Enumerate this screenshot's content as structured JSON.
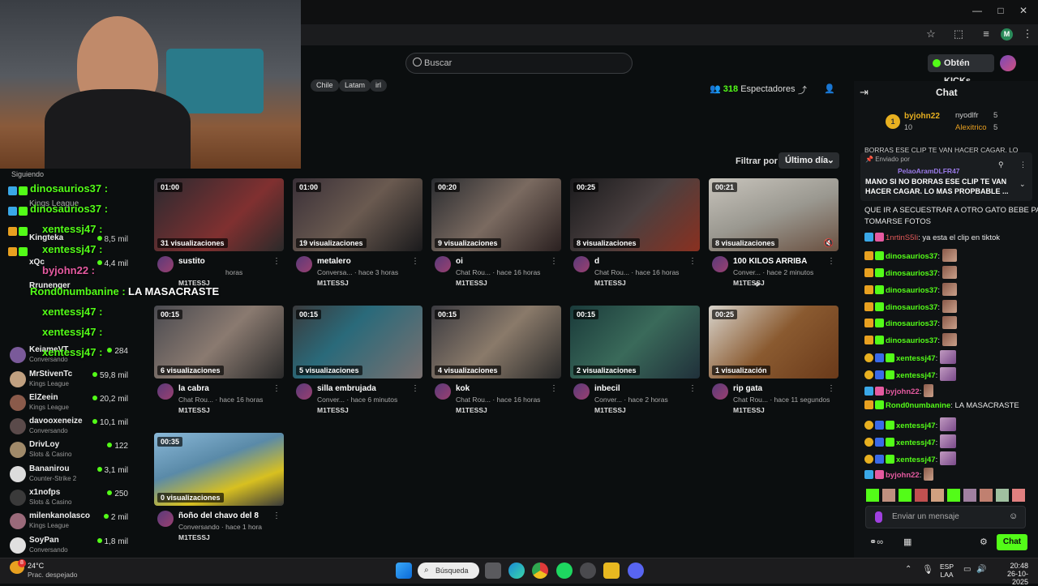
{
  "browser": {
    "window_controls": [
      "—",
      "□",
      "✕"
    ]
  },
  "header": {
    "search_placeholder": "Buscar",
    "kicks_button": "Obtén KICKs"
  },
  "stream": {
    "tags": [
      "Chile",
      "Latam",
      "irl"
    ],
    "viewers_count": "318",
    "viewers_label": "Espectadores"
  },
  "clips": {
    "filter_label": "Filtrar por:",
    "filter_value": "Último día",
    "items": [
      {
        "duration": "01:00",
        "views": "31 visualizaciones",
        "title": "sustito",
        "meta": "horas",
        "user": "M1TESSJ"
      },
      {
        "duration": "01:00",
        "views": "19 visualizaciones",
        "title": "metalero",
        "meta": "Conversa... · hace 3 horas",
        "user": "M1TESSJ"
      },
      {
        "duration": "00:20",
        "views": "9 visualizaciones",
        "title": "oi",
        "meta": "Chat Rou... · hace 16 horas",
        "user": "M1TESSJ"
      },
      {
        "duration": "00:25",
        "views": "8 visualizaciones",
        "title": "d",
        "meta": "Chat Rou... · hace 16 horas",
        "user": "M1TESSJ"
      },
      {
        "duration": "00:21",
        "views": "8 visualizaciones",
        "title": "100 KILOS ARRIBA",
        "meta": "Conver... · hace 2 minutos",
        "user": "M1TESSJ"
      },
      {
        "duration": "00:15",
        "views": "6 visualizaciones",
        "title": "la cabra",
        "meta": "Chat Rou... · hace 16 horas",
        "user": "M1TESSJ"
      },
      {
        "duration": "00:15",
        "views": "5 visualizaciones",
        "title": "silla embrujada",
        "meta": "Conver... · hace 6 minutos",
        "user": "M1TESSJ"
      },
      {
        "duration": "00:15",
        "views": "4 visualizaciones",
        "title": "kok",
        "meta": "Chat Rou... · hace 16 horas",
        "user": "M1TESSJ"
      },
      {
        "duration": "00:15",
        "views": "2 visualizaciones",
        "title": "inbecil",
        "meta": "Conver... · hace 2 horas",
        "user": "M1TESSJ"
      },
      {
        "duration": "00:25",
        "views": "1 visualización",
        "title": "rip gata",
        "meta": "Chat Rou... · hace 11 segundos",
        "user": "M1TESSJ"
      },
      {
        "duration": "00:35",
        "views": "0 visualizaciones",
        "title": "ñoño del chavo del 8",
        "meta": "Conversando · hace 1 hora",
        "user": "M1TESSJ"
      }
    ]
  },
  "sidebar": {
    "heading": "Siguiendo",
    "items": [
      {
        "name": "Kings League",
        "category": "",
        "count": ""
      },
      {
        "name": "Kingteka",
        "category": "",
        "count": "8,5 mil"
      },
      {
        "name": "xQc",
        "category": "",
        "count": "4,4 mil"
      },
      {
        "name": "Rrunenger",
        "category": "",
        "count": ""
      },
      {
        "name": "KeiameVT",
        "category": "Conversando",
        "count": "284"
      },
      {
        "name": "MrStivenTc",
        "category": "Kings League",
        "count": "59,8 mil"
      },
      {
        "name": "ElZeein",
        "category": "Kings League",
        "count": "20,2 mil"
      },
      {
        "name": "davooxeneize",
        "category": "Conversando",
        "count": "10,1 mil"
      },
      {
        "name": "DrivLoy",
        "category": "Slots & Casino",
        "count": "122"
      },
      {
        "name": "Bananirou",
        "category": "Counter-Strike 2",
        "count": "3,1 mil"
      },
      {
        "name": "x1nofps",
        "category": "Slots & Casino",
        "count": "250"
      },
      {
        "name": "milenkanolasco",
        "category": "Kings League",
        "count": "2 mil"
      },
      {
        "name": "SoyPan",
        "category": "Conversando",
        "count": "1,8 mil"
      }
    ]
  },
  "overlay_chat": [
    {
      "text": "dinosaurios37 :",
      "color": "#53fc18"
    },
    {
      "text": "dinosaurios37 :",
      "color": "#53fc18"
    },
    {
      "text": "xentessj47 :",
      "color": "#53fc18"
    },
    {
      "text": "xentessj47 :",
      "color": "#53fc18"
    },
    {
      "text": "byjohn22 :",
      "color": "#e55aa0"
    },
    {
      "text": "Rond0numbanine :",
      "color": "#53fc18",
      "message": "LA MASACRASTE"
    },
    {
      "text": "xentessj47 :",
      "color": "#53fc18"
    },
    {
      "text": "xentessj47 :",
      "color": "#53fc18"
    },
    {
      "text": "xentessj47 :",
      "color": "#53fc18"
    }
  ],
  "chat": {
    "title": "Chat",
    "top_gifters": [
      {
        "rank": "1",
        "name": "byjohn22",
        "count": "10"
      },
      {
        "name": "nyodlfr",
        "count": "5"
      },
      {
        "name": "Alexitrico",
        "count": "5"
      }
    ],
    "pinned_cut": "BORRAS ESE CLIP TE VAN HACER CAGAR. LO",
    "pinned_by_label": "Enviado por",
    "pinned_user": "PelaoAramDLFR47",
    "pinned_message": "MANO SI NO BORRAS ESE CLIP TE VAN HACER CAGAR. LO MAS PROPBABLE ...",
    "messages": [
      {
        "user": "",
        "text": "QUE IR A SECUESTRAR A OTRO GATO BEBE PA",
        "color": "#e8e8e8"
      },
      {
        "user": "",
        "text": "TOMARSE FOTOS",
        "color": "#e8e8e8"
      },
      {
        "user": "1nrtinS5Ii",
        "text": ": ya esta el clip en tiktok",
        "color": "#e55a5a"
      },
      {
        "user": "dinosaurios37",
        "text": ":",
        "color": "#53fc18"
      },
      {
        "user": "dinosaurios37",
        "text": ":",
        "color": "#53fc18"
      },
      {
        "user": "dinosaurios37",
        "text": ":",
        "color": "#53fc18"
      },
      {
        "user": "dinosaurios37",
        "text": ":",
        "color": "#53fc18"
      },
      {
        "user": "dinosaurios37",
        "text": ":",
        "color": "#53fc18"
      },
      {
        "user": "dinosaurios37",
        "text": ":",
        "color": "#53fc18"
      },
      {
        "user": "xentessj47",
        "text": ":",
        "color": "#53fc18"
      },
      {
        "user": "xentessj47",
        "text": ":",
        "color": "#53fc18"
      },
      {
        "user": "byjohn22",
        "text": ":",
        "color": "#e55aa0"
      },
      {
        "user": "Rond0numbanine",
        "text": ": LA MASACRASTE",
        "color": "#53fc18"
      },
      {
        "user": "xentessj47",
        "text": ":",
        "color": "#53fc18"
      },
      {
        "user": "xentessj47",
        "text": ":",
        "color": "#53fc18"
      },
      {
        "user": "xentessj47",
        "text": ":",
        "color": "#53fc18"
      },
      {
        "user": "byjohn22",
        "text": ":",
        "color": "#e55aa0"
      }
    ],
    "input_placeholder": "Enviar un mensaje",
    "send_label": "Chat"
  },
  "taskbar": {
    "weather_temp": "24°C",
    "weather_desc": "Prac. despejado",
    "search_label": "Búsqueda",
    "lang_top": "ESP",
    "lang_bottom": "LAA",
    "time": "20:48",
    "date": "26-10-2025",
    "notification_count": "8"
  },
  "colors": {
    "accent": "#53fc18",
    "background": "#0b0e0f",
    "panel": "#0f1214"
  }
}
